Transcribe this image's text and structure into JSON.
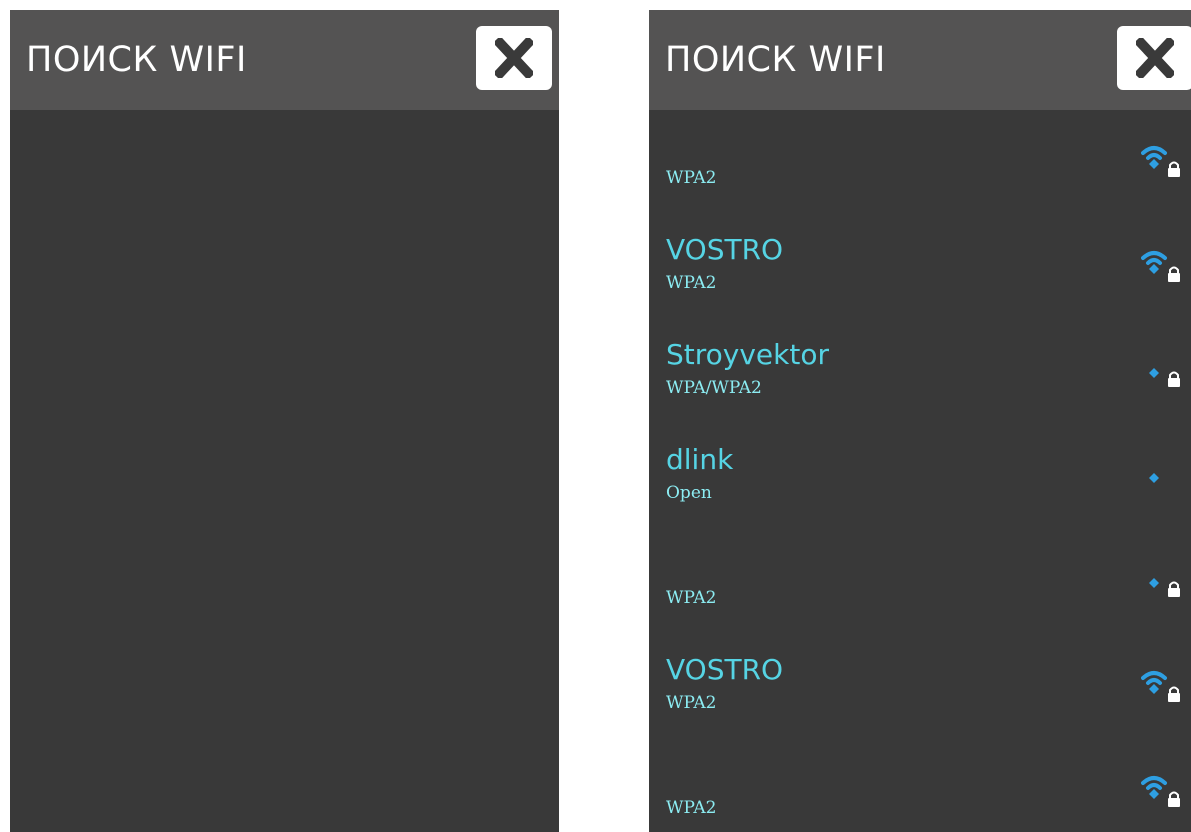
{
  "colors": {
    "background": "#393939",
    "header": "#545353",
    "ssid": "#56d4e4",
    "security": "#8cecf2",
    "signal": "#2e9fe2"
  },
  "left_panel": {
    "title": "ПОИСК WIFI",
    "close_icon": "close-icon"
  },
  "right_panel": {
    "title": "ПОИСК WIFI",
    "close_icon": "close-icon",
    "networks": [
      {
        "ssid": "",
        "security": "WPA2",
        "signal": "strong",
        "locked": true
      },
      {
        "ssid": "VOSTRO",
        "security": "WPA2",
        "signal": "strong",
        "locked": true
      },
      {
        "ssid": "Stroyvektor",
        "security": "WPA/WPA2",
        "signal": "weak",
        "locked": true
      },
      {
        "ssid": "dlink",
        "security": "Open",
        "signal": "weak",
        "locked": false
      },
      {
        "ssid": "",
        "security": "WPA2",
        "signal": "weak",
        "locked": true
      },
      {
        "ssid": "VOSTRO",
        "security": "WPA2",
        "signal": "strong",
        "locked": true
      },
      {
        "ssid": "",
        "security": "WPA2",
        "signal": "strong",
        "locked": true
      }
    ]
  }
}
